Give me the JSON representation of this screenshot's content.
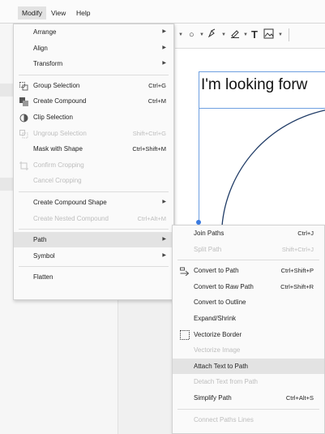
{
  "menubar": [
    {
      "label": "Modify",
      "active": true
    },
    {
      "label": "View",
      "active": false
    },
    {
      "label": "Help",
      "active": false
    }
  ],
  "canvas": {
    "text": "I'm looking forw"
  },
  "modify_menu": {
    "items": [
      {
        "label": "Arrange",
        "shortcut": "",
        "submenu": true,
        "disabled": false,
        "icon": ""
      },
      {
        "label": "Align",
        "shortcut": "",
        "submenu": true,
        "disabled": false,
        "icon": ""
      },
      {
        "label": "Transform",
        "shortcut": "",
        "submenu": true,
        "disabled": false,
        "icon": ""
      },
      {
        "sep": true
      },
      {
        "label": "Group Selection",
        "shortcut": "Ctrl+G",
        "submenu": false,
        "disabled": false,
        "icon": "group-icon"
      },
      {
        "label": "Create Compound",
        "shortcut": "Ctrl+M",
        "submenu": false,
        "disabled": false,
        "icon": "compound-icon"
      },
      {
        "label": "Clip Selection",
        "shortcut": "",
        "submenu": false,
        "disabled": false,
        "icon": "clip-icon"
      },
      {
        "label": "Ungroup Selection",
        "shortcut": "Shift+Ctrl+G",
        "submenu": false,
        "disabled": true,
        "icon": "ungroup-icon"
      },
      {
        "label": "Mask with Shape",
        "shortcut": "Ctrl+Shift+M",
        "submenu": false,
        "disabled": false,
        "icon": ""
      },
      {
        "label": "Confirm Cropping",
        "shortcut": "",
        "submenu": false,
        "disabled": true,
        "icon": "crop-icon"
      },
      {
        "label": "Cancel Cropping",
        "shortcut": "",
        "submenu": false,
        "disabled": true,
        "icon": ""
      },
      {
        "sep": true
      },
      {
        "label": "Create Compound Shape",
        "shortcut": "",
        "submenu": true,
        "disabled": false,
        "icon": ""
      },
      {
        "label": "Create Nested Compound",
        "shortcut": "Ctrl+Alt+M",
        "submenu": false,
        "disabled": true,
        "icon": ""
      },
      {
        "sep": true
      },
      {
        "label": "Path",
        "shortcut": "",
        "submenu": true,
        "disabled": false,
        "icon": "",
        "highlighted": true
      },
      {
        "label": "Symbol",
        "shortcut": "",
        "submenu": true,
        "disabled": false,
        "icon": ""
      },
      {
        "sep": true
      },
      {
        "label": "Flatten",
        "shortcut": "",
        "submenu": false,
        "disabled": false,
        "icon": ""
      }
    ]
  },
  "path_menu": {
    "items": [
      {
        "label": "Join Paths",
        "shortcut": "Ctrl+J",
        "disabled": false,
        "icon": ""
      },
      {
        "label": "Split Path",
        "shortcut": "Shift+Ctrl+J",
        "disabled": true,
        "icon": ""
      },
      {
        "sep": true
      },
      {
        "label": "Convert to Path",
        "shortcut": "Ctrl+Shift+P",
        "disabled": false,
        "icon": "convert-path-icon"
      },
      {
        "label": "Convert to Raw Path",
        "shortcut": "Ctrl+Shift+R",
        "disabled": false,
        "icon": ""
      },
      {
        "label": "Convert to Outline",
        "shortcut": "",
        "disabled": false,
        "icon": ""
      },
      {
        "label": "Expand/Shrink",
        "shortcut": "",
        "disabled": false,
        "icon": ""
      },
      {
        "label": "Vectorize Border",
        "shortcut": "",
        "disabled": false,
        "icon": "vectorize-border-icon"
      },
      {
        "label": "Vectorize Image",
        "shortcut": "",
        "disabled": true,
        "icon": ""
      },
      {
        "label": "Attach Text to Path",
        "shortcut": "",
        "disabled": false,
        "icon": "",
        "highlighted": true
      },
      {
        "label": "Detach Text from Path",
        "shortcut": "",
        "disabled": true,
        "icon": ""
      },
      {
        "label": "Simplify Path",
        "shortcut": "Ctrl+Alt+S",
        "disabled": false,
        "icon": ""
      },
      {
        "sep": true
      },
      {
        "label": "Connect Paths Lines",
        "shortcut": "",
        "disabled": true,
        "icon": ""
      }
    ]
  }
}
